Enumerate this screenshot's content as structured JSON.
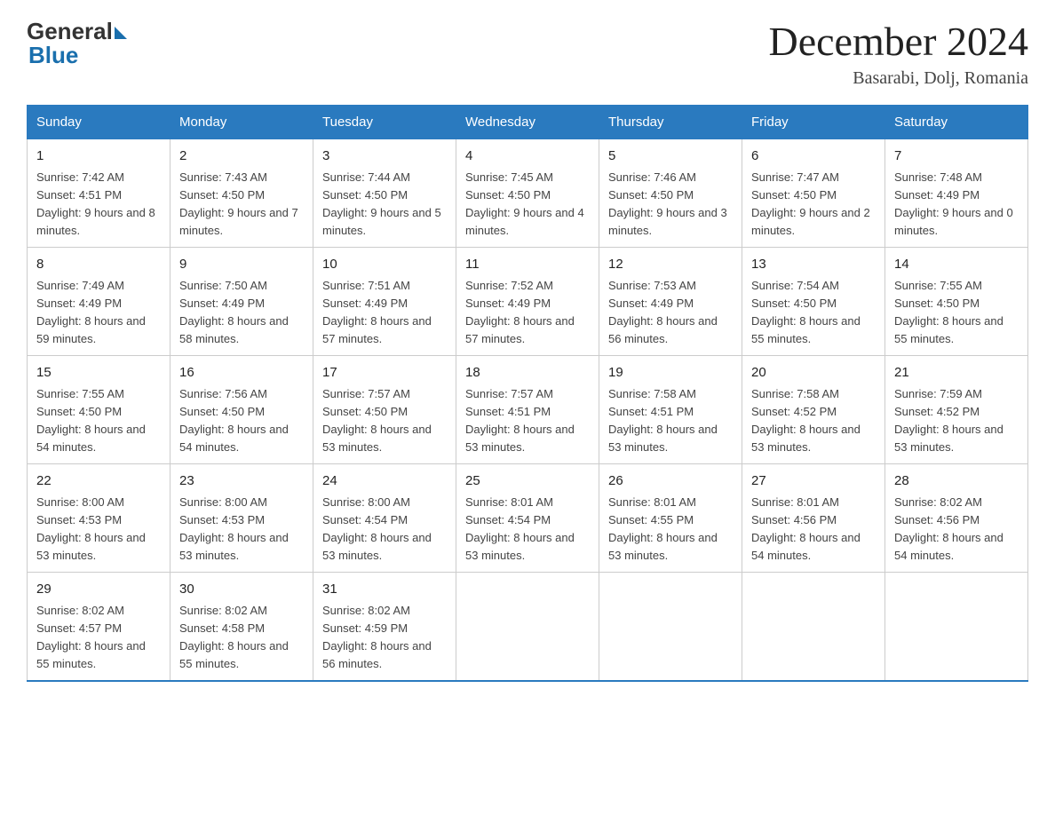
{
  "header": {
    "month_year": "December 2024",
    "location": "Basarabi, Dolj, Romania"
  },
  "days_of_week": [
    "Sunday",
    "Monday",
    "Tuesday",
    "Wednesday",
    "Thursday",
    "Friday",
    "Saturday"
  ],
  "weeks": [
    [
      {
        "day": "1",
        "sunrise": "7:42 AM",
        "sunset": "4:51 PM",
        "daylight": "9 hours and 8 minutes."
      },
      {
        "day": "2",
        "sunrise": "7:43 AM",
        "sunset": "4:50 PM",
        "daylight": "9 hours and 7 minutes."
      },
      {
        "day": "3",
        "sunrise": "7:44 AM",
        "sunset": "4:50 PM",
        "daylight": "9 hours and 5 minutes."
      },
      {
        "day": "4",
        "sunrise": "7:45 AM",
        "sunset": "4:50 PM",
        "daylight": "9 hours and 4 minutes."
      },
      {
        "day": "5",
        "sunrise": "7:46 AM",
        "sunset": "4:50 PM",
        "daylight": "9 hours and 3 minutes."
      },
      {
        "day": "6",
        "sunrise": "7:47 AM",
        "sunset": "4:50 PM",
        "daylight": "9 hours and 2 minutes."
      },
      {
        "day": "7",
        "sunrise": "7:48 AM",
        "sunset": "4:49 PM",
        "daylight": "9 hours and 0 minutes."
      }
    ],
    [
      {
        "day": "8",
        "sunrise": "7:49 AM",
        "sunset": "4:49 PM",
        "daylight": "8 hours and 59 minutes."
      },
      {
        "day": "9",
        "sunrise": "7:50 AM",
        "sunset": "4:49 PM",
        "daylight": "8 hours and 58 minutes."
      },
      {
        "day": "10",
        "sunrise": "7:51 AM",
        "sunset": "4:49 PM",
        "daylight": "8 hours and 57 minutes."
      },
      {
        "day": "11",
        "sunrise": "7:52 AM",
        "sunset": "4:49 PM",
        "daylight": "8 hours and 57 minutes."
      },
      {
        "day": "12",
        "sunrise": "7:53 AM",
        "sunset": "4:49 PM",
        "daylight": "8 hours and 56 minutes."
      },
      {
        "day": "13",
        "sunrise": "7:54 AM",
        "sunset": "4:50 PM",
        "daylight": "8 hours and 55 minutes."
      },
      {
        "day": "14",
        "sunrise": "7:55 AM",
        "sunset": "4:50 PM",
        "daylight": "8 hours and 55 minutes."
      }
    ],
    [
      {
        "day": "15",
        "sunrise": "7:55 AM",
        "sunset": "4:50 PM",
        "daylight": "8 hours and 54 minutes."
      },
      {
        "day": "16",
        "sunrise": "7:56 AM",
        "sunset": "4:50 PM",
        "daylight": "8 hours and 54 minutes."
      },
      {
        "day": "17",
        "sunrise": "7:57 AM",
        "sunset": "4:50 PM",
        "daylight": "8 hours and 53 minutes."
      },
      {
        "day": "18",
        "sunrise": "7:57 AM",
        "sunset": "4:51 PM",
        "daylight": "8 hours and 53 minutes."
      },
      {
        "day": "19",
        "sunrise": "7:58 AM",
        "sunset": "4:51 PM",
        "daylight": "8 hours and 53 minutes."
      },
      {
        "day": "20",
        "sunrise": "7:58 AM",
        "sunset": "4:52 PM",
        "daylight": "8 hours and 53 minutes."
      },
      {
        "day": "21",
        "sunrise": "7:59 AM",
        "sunset": "4:52 PM",
        "daylight": "8 hours and 53 minutes."
      }
    ],
    [
      {
        "day": "22",
        "sunrise": "8:00 AM",
        "sunset": "4:53 PM",
        "daylight": "8 hours and 53 minutes."
      },
      {
        "day": "23",
        "sunrise": "8:00 AM",
        "sunset": "4:53 PM",
        "daylight": "8 hours and 53 minutes."
      },
      {
        "day": "24",
        "sunrise": "8:00 AM",
        "sunset": "4:54 PM",
        "daylight": "8 hours and 53 minutes."
      },
      {
        "day": "25",
        "sunrise": "8:01 AM",
        "sunset": "4:54 PM",
        "daylight": "8 hours and 53 minutes."
      },
      {
        "day": "26",
        "sunrise": "8:01 AM",
        "sunset": "4:55 PM",
        "daylight": "8 hours and 53 minutes."
      },
      {
        "day": "27",
        "sunrise": "8:01 AM",
        "sunset": "4:56 PM",
        "daylight": "8 hours and 54 minutes."
      },
      {
        "day": "28",
        "sunrise": "8:02 AM",
        "sunset": "4:56 PM",
        "daylight": "8 hours and 54 minutes."
      }
    ],
    [
      {
        "day": "29",
        "sunrise": "8:02 AM",
        "sunset": "4:57 PM",
        "daylight": "8 hours and 55 minutes."
      },
      {
        "day": "30",
        "sunrise": "8:02 AM",
        "sunset": "4:58 PM",
        "daylight": "8 hours and 55 minutes."
      },
      {
        "day": "31",
        "sunrise": "8:02 AM",
        "sunset": "4:59 PM",
        "daylight": "8 hours and 56 minutes."
      },
      null,
      null,
      null,
      null
    ]
  ]
}
